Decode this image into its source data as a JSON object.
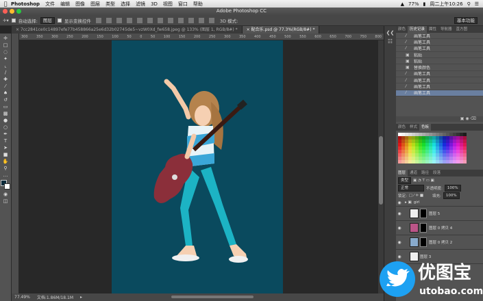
{
  "mac_menubar": {
    "app": "Photoshop",
    "items": [
      "文件",
      "编辑",
      "图像",
      "图层",
      "类型",
      "选择",
      "滤镜",
      "3D",
      "视图",
      "窗口",
      "帮助"
    ],
    "battery": "77%",
    "clock": "周二上午10:26"
  },
  "window": {
    "title": "Adobe Photoshop CC"
  },
  "options": {
    "auto_select_label": "自动选择:",
    "auto_select_value": "图层",
    "show_transform_label": "显示变换控件",
    "mode_3d": "3D 模式:",
    "workspace": "基本功能"
  },
  "doc_tabs": [
    "7cc2841ce0c14897efe77b458866a25e6d32b02745de5~vzW0Xd_fw658.jpeg @ 133% (图层 1, RGB/8#) *",
    "配合乐.psd @ 77.3%(RGB/8#) *"
  ],
  "ruler": [
    "300",
    "350",
    "300",
    "250",
    "200",
    "150",
    "100",
    "50",
    "0",
    "50",
    "100",
    "150",
    "200",
    "250",
    "300",
    "350",
    "400",
    "450",
    "500",
    "550",
    "600",
    "650",
    "700",
    "750",
    "800"
  ],
  "status": {
    "zoom": "77.49%",
    "doc": "文档:1.86M/18.1M"
  },
  "panel_tabs": {
    "top": [
      "颜色",
      "历史记录",
      "属性",
      "导航器",
      "直方图"
    ],
    "middle": [
      "颜色",
      "样式",
      "色板"
    ],
    "bottom": [
      "图层",
      "通道",
      "路径",
      "段落"
    ]
  },
  "history": [
    "画笔工具",
    "画笔工具",
    "画笔工具",
    "粘贴",
    "粘贴",
    "替换颜色",
    "画笔工具",
    "画笔工具",
    "画笔工具",
    "画笔工具"
  ],
  "layers": {
    "filter": "类型",
    "blend": "正常",
    "opacity_label": "不透明度:",
    "opacity": "100%",
    "lock_label": "锁定:",
    "fill_label": "填充:",
    "fill": "100%",
    "group": "girl",
    "items": [
      "图层 5",
      "图层 0 拷贝 4",
      "图层 0 拷贝 2",
      "图层 3"
    ]
  },
  "watermark": {
    "cn": "优图宝",
    "url": "utobao.com"
  },
  "colors": {
    "doc_bg": "#0a4a5e",
    "selected": "#6a7fa0",
    "twitter": "#1da1f2"
  }
}
